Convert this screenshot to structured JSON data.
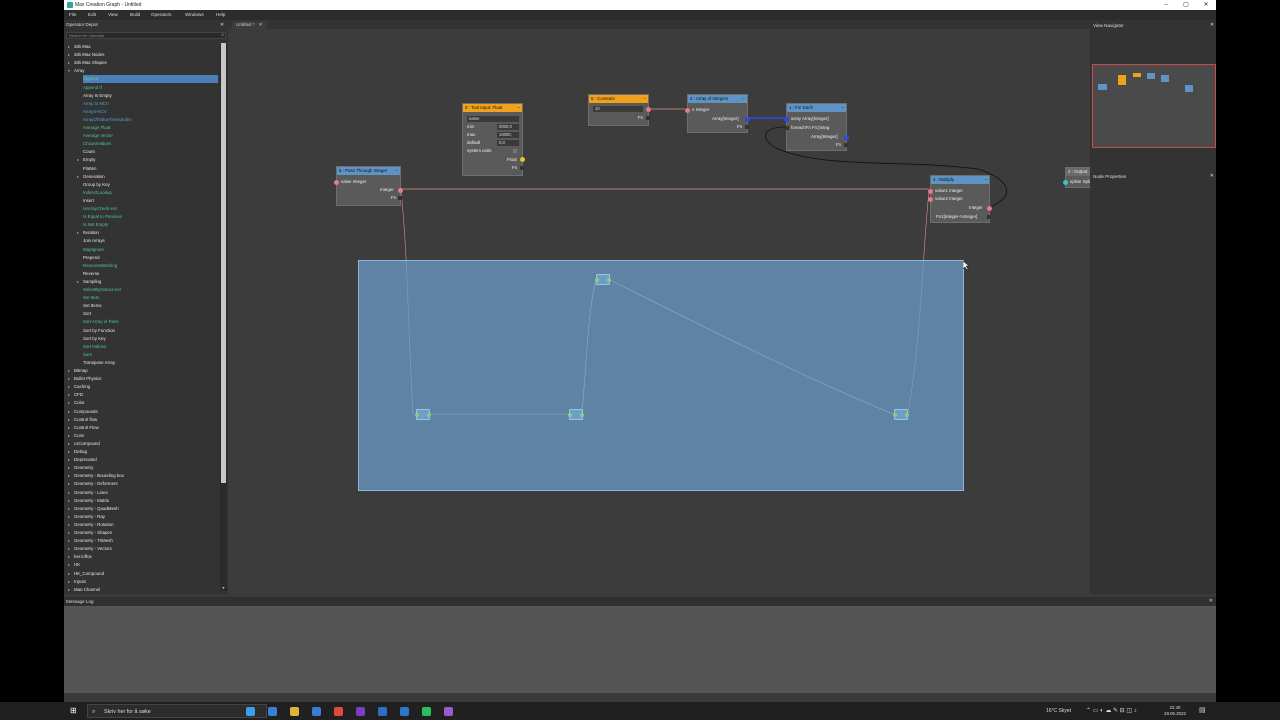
{
  "window": {
    "title": "Max Creation Graph - Untitled",
    "minimize": "–",
    "maximize": "▢",
    "close": "✕"
  },
  "menu": [
    "File",
    "Edit",
    "View",
    "Build",
    "Operators",
    "Windows",
    "Help"
  ],
  "tab": {
    "label": "Untitled *",
    "close": "✕"
  },
  "depot": {
    "title": "Operator Depot",
    "close": "✕",
    "search_placeholder": "Search for Operator",
    "items": [
      {
        "label": "3ds Max",
        "indent": 0,
        "color": "#e6e6e6",
        "arrow": "▸",
        "selected": false
      },
      {
        "label": "3ds Max Nodes",
        "indent": 0,
        "color": "#e6e6e6",
        "arrow": "▸",
        "selected": false
      },
      {
        "label": "3ds Max Shapes",
        "indent": 0,
        "color": "#e6e6e6",
        "arrow": "▸",
        "selected": false
      },
      {
        "label": "Array",
        "indent": 0,
        "color": "#e6e6e6",
        "arrow": "▾",
        "selected": false
      },
      {
        "label": "Append",
        "indent": 1,
        "color": "#5fd0a0",
        "arrow": "",
        "selected": true
      },
      {
        "label": "Append If",
        "indent": 1,
        "color": "#4fc79a",
        "arrow": "",
        "selected": false
      },
      {
        "label": "Array Is Empty",
        "indent": 1,
        "color": "#e6e6e6",
        "arrow": "",
        "selected": false
      },
      {
        "label": "Array to NCV",
        "indent": 1,
        "color": "#4fa3d9",
        "arrow": "",
        "selected": false
      },
      {
        "label": "Array4-NCV",
        "indent": 1,
        "color": "#4fa3d9",
        "arrow": "",
        "selected": false
      },
      {
        "label": "ArrayOfValueTimesIndex",
        "indent": 1,
        "color": "#4fa3d9",
        "arrow": "",
        "selected": false
      },
      {
        "label": "Average Float",
        "indent": 1,
        "color": "#4fc79a",
        "arrow": "",
        "selected": false
      },
      {
        "label": "Average Vector",
        "indent": 1,
        "color": "#4fc79a",
        "arrow": "",
        "selected": false
      },
      {
        "label": "ChooseValues",
        "indent": 1,
        "color": "#4fc79a",
        "arrow": "",
        "selected": false
      },
      {
        "label": "Count",
        "indent": 1,
        "color": "#e6e6e6",
        "arrow": "",
        "selected": false
      },
      {
        "label": "Empty",
        "indent": 1,
        "color": "#e6e6e6",
        "arrow": "▸",
        "selected": false
      },
      {
        "label": "Flatten",
        "indent": 1,
        "color": "#e6e6e6",
        "arrow": "",
        "selected": false
      },
      {
        "label": "Generation",
        "indent": 1,
        "color": "#e6e6e6",
        "arrow": "▸",
        "selected": false
      },
      {
        "label": "Group by Key",
        "indent": 1,
        "color": "#e6e6e6",
        "arrow": "",
        "selected": false
      },
      {
        "label": "IndirectLookup",
        "indent": 1,
        "color": "#4fc79a",
        "arrow": "",
        "selected": false
      },
      {
        "label": "Insert",
        "indent": 1,
        "color": "#e6e6e6",
        "arrow": "",
        "selected": false
      },
      {
        "label": "IsArrayCheck-ext",
        "indent": 1,
        "color": "#4fc79a",
        "arrow": "",
        "selected": false
      },
      {
        "label": "Is Equal to Previous",
        "indent": 1,
        "color": "#4fc79a",
        "arrow": "",
        "selected": false
      },
      {
        "label": "Is Not Empty",
        "indent": 1,
        "color": "#4fc79a",
        "arrow": "",
        "selected": false
      },
      {
        "label": "Iteration",
        "indent": 1,
        "color": "#e6e6e6",
        "arrow": "▸",
        "selected": false
      },
      {
        "label": "Join Arrays",
        "indent": 1,
        "color": "#e6e6e6",
        "arrow": "",
        "selected": false
      },
      {
        "label": "MapIgnore",
        "indent": 1,
        "color": "#4fc79a",
        "arrow": "",
        "selected": false
      },
      {
        "label": "Prepend",
        "indent": 1,
        "color": "#e6e6e6",
        "arrow": "",
        "selected": false
      },
      {
        "label": "RemoveMatching",
        "indent": 1,
        "color": "#4fc79a",
        "arrow": "",
        "selected": false
      },
      {
        "label": "Reverse",
        "indent": 1,
        "color": "#e6e6e6",
        "arrow": "",
        "selected": false
      },
      {
        "label": "Sampling",
        "indent": 1,
        "color": "#e6e6e6",
        "arrow": "▸",
        "selected": false
      },
      {
        "label": "SelectByIndex2-ext",
        "indent": 1,
        "color": "#4fc79a",
        "arrow": "",
        "selected": false
      },
      {
        "label": "Set Item",
        "indent": 1,
        "color": "#4fc79a",
        "arrow": "",
        "selected": false
      },
      {
        "label": "Set Items",
        "indent": 1,
        "color": "#e6e6e6",
        "arrow": "",
        "selected": false
      },
      {
        "label": "Sort",
        "indent": 1,
        "color": "#e6e6e6",
        "arrow": "",
        "selected": false
      },
      {
        "label": "Sort Array of Pairs",
        "indent": 1,
        "color": "#4fc79a",
        "arrow": "",
        "selected": false
      },
      {
        "label": "Sort by Function",
        "indent": 1,
        "color": "#e6e6e6",
        "arrow": "",
        "selected": false
      },
      {
        "label": "Sort by Key",
        "indent": 1,
        "color": "#e6e6e6",
        "arrow": "",
        "selected": false
      },
      {
        "label": "Sort Indices",
        "indent": 1,
        "color": "#4fc79a",
        "arrow": "",
        "selected": false
      },
      {
        "label": "Sum",
        "indent": 1,
        "color": "#4fc79a",
        "arrow": "",
        "selected": false
      },
      {
        "label": "Transpose Array",
        "indent": 1,
        "color": "#e6e6e6",
        "arrow": "",
        "selected": false
      },
      {
        "label": "Bitmap",
        "indent": 0,
        "color": "#e6e6e6",
        "arrow": "▸",
        "selected": false
      },
      {
        "label": "Bullet Physics",
        "indent": 0,
        "color": "#e6e6e6",
        "arrow": "▸",
        "selected": false
      },
      {
        "label": "Caching",
        "indent": 0,
        "color": "#e6e6e6",
        "arrow": "▸",
        "selected": false
      },
      {
        "label": "CFD",
        "indent": 0,
        "color": "#e6e6e6",
        "arrow": "▸",
        "selected": false
      },
      {
        "label": "Color",
        "indent": 0,
        "color": "#e6e6e6",
        "arrow": "▸",
        "selected": false
      },
      {
        "label": "Compounds",
        "indent": 0,
        "color": "#e6e6e6",
        "arrow": "▸",
        "selected": false
      },
      {
        "label": "Control flow",
        "indent": 0,
        "color": "#e6e6e6",
        "arrow": "▸",
        "selected": false
      },
      {
        "label": "Control Flow",
        "indent": 0,
        "color": "#e6e6e6",
        "arrow": "▸",
        "selected": false
      },
      {
        "label": "Conv",
        "indent": 0,
        "color": "#e6e6e6",
        "arrow": "▸",
        "selected": false
      },
      {
        "label": "csCompound",
        "indent": 0,
        "color": "#e6e6e6",
        "arrow": "▸",
        "selected": false
      },
      {
        "label": "Debug",
        "indent": 0,
        "color": "#e6e6e6",
        "arrow": "▸",
        "selected": false
      },
      {
        "label": "Deprecated",
        "indent": 0,
        "color": "#e6e6e6",
        "arrow": "▸",
        "selected": false
      },
      {
        "label": "Geometry",
        "indent": 0,
        "color": "#e6e6e6",
        "arrow": "▸",
        "selected": false
      },
      {
        "label": "Geometry - Bounding box",
        "indent": 0,
        "color": "#e6e6e6",
        "arrow": "▸",
        "selected": false
      },
      {
        "label": "Geometry - Deformers",
        "indent": 0,
        "color": "#e6e6e6",
        "arrow": "▸",
        "selected": false
      },
      {
        "label": "Geometry - Lines",
        "indent": 0,
        "color": "#e6e6e6",
        "arrow": "▸",
        "selected": false
      },
      {
        "label": "Geometry - Matrix",
        "indent": 0,
        "color": "#e6e6e6",
        "arrow": "▸",
        "selected": false
      },
      {
        "label": "Geometry - QuadMesh",
        "indent": 0,
        "color": "#e6e6e6",
        "arrow": "▸",
        "selected": false
      },
      {
        "label": "Geometry - Ray",
        "indent": 0,
        "color": "#e6e6e6",
        "arrow": "▸",
        "selected": false
      },
      {
        "label": "Geometry - Rotation",
        "indent": 0,
        "color": "#e6e6e6",
        "arrow": "▸",
        "selected": false
      },
      {
        "label": "Geometry - Shapes",
        "indent": 0,
        "color": "#e6e6e6",
        "arrow": "▸",
        "selected": false
      },
      {
        "label": "Geometry - TriMesh",
        "indent": 0,
        "color": "#e6e6e6",
        "arrow": "▸",
        "selected": false
      },
      {
        "label": "Geometry - Vectors",
        "indent": 0,
        "color": "#e6e6e6",
        "arrow": "▸",
        "selected": false
      },
      {
        "label": "her.loffox",
        "indent": 0,
        "color": "#e6e6e6",
        "arrow": "▸",
        "selected": false
      },
      {
        "label": "HK",
        "indent": 0,
        "color": "#e6e6e6",
        "arrow": "▸",
        "selected": false
      },
      {
        "label": "HK_Compound",
        "indent": 0,
        "color": "#e6e6e6",
        "arrow": "▸",
        "selected": false
      },
      {
        "label": "Inputs",
        "indent": 0,
        "color": "#e6e6e6",
        "arrow": "▸",
        "selected": false
      },
      {
        "label": "Map Channel",
        "indent": 0,
        "color": "#e6e6e6",
        "arrow": "▸",
        "selected": false
      }
    ]
  },
  "nodes": {
    "tool_input": {
      "title": "0 : Tool Input: Float",
      "name_field": "name",
      "min_label": "min",
      "min_value": "0000,0",
      "max_label": "max",
      "max_value": "10000,",
      "default_label": "default",
      "default_value": "0,0",
      "system_units_label": "system units",
      "out_type": "Float",
      "fn": "Fn"
    },
    "constant": {
      "title": "5 : Constant",
      "value": "10",
      "fn": "Fn"
    },
    "array_ints": {
      "title": "4 : Array of Integers",
      "in_label": "n Integer",
      "out_label": "Array[Integer]",
      "fn": "Fn"
    },
    "for_each": {
      "title": "1 : For Each",
      "in1": "array Array[Integer]",
      "in2": "foreachFn Fn:[Integ",
      "out": "Array[Integer]",
      "fn": "Fn"
    },
    "pass_through": {
      "title": "6 : Pass Through Integer",
      "in": "value Integer",
      "out": "Integer",
      "fn": "Fn"
    },
    "multiply": {
      "title": "3 : Multiply",
      "in1": "value1 Integer",
      "in2": "value2 Integer",
      "out": "Integer",
      "fn": "Fn1[Integer->Integer]"
    },
    "output_spline": {
      "title": "2 : Output: Spline",
      "in": "spline Spline"
    }
  },
  "right_panel": {
    "navigator_title": "View Navigator",
    "properties_title": "Node Properties",
    "close": "✕"
  },
  "message_log": {
    "title": "Message Log",
    "close": "✕"
  },
  "taskbar": {
    "search_text": "Skriv her for å søke",
    "weather": "16°C  Skyet",
    "time": "22:40",
    "date": "28.06.2022",
    "icons": [
      "#3aa0e8",
      "#3b7fd4",
      "#e0b23a",
      "#3a7bd5",
      "#e04a3a",
      "#7a3dc0",
      "#2d6fc4",
      "#2a78c8",
      "#2bbf5a",
      "#9a5ad0",
      "#2aa7a0"
    ]
  },
  "colors": {
    "header_blue": "#5e93c6",
    "header_orange": "#f1a21c",
    "selection": "#6fa2cd",
    "int_port": "#e87a86",
    "array_port": "#2a4de0"
  }
}
